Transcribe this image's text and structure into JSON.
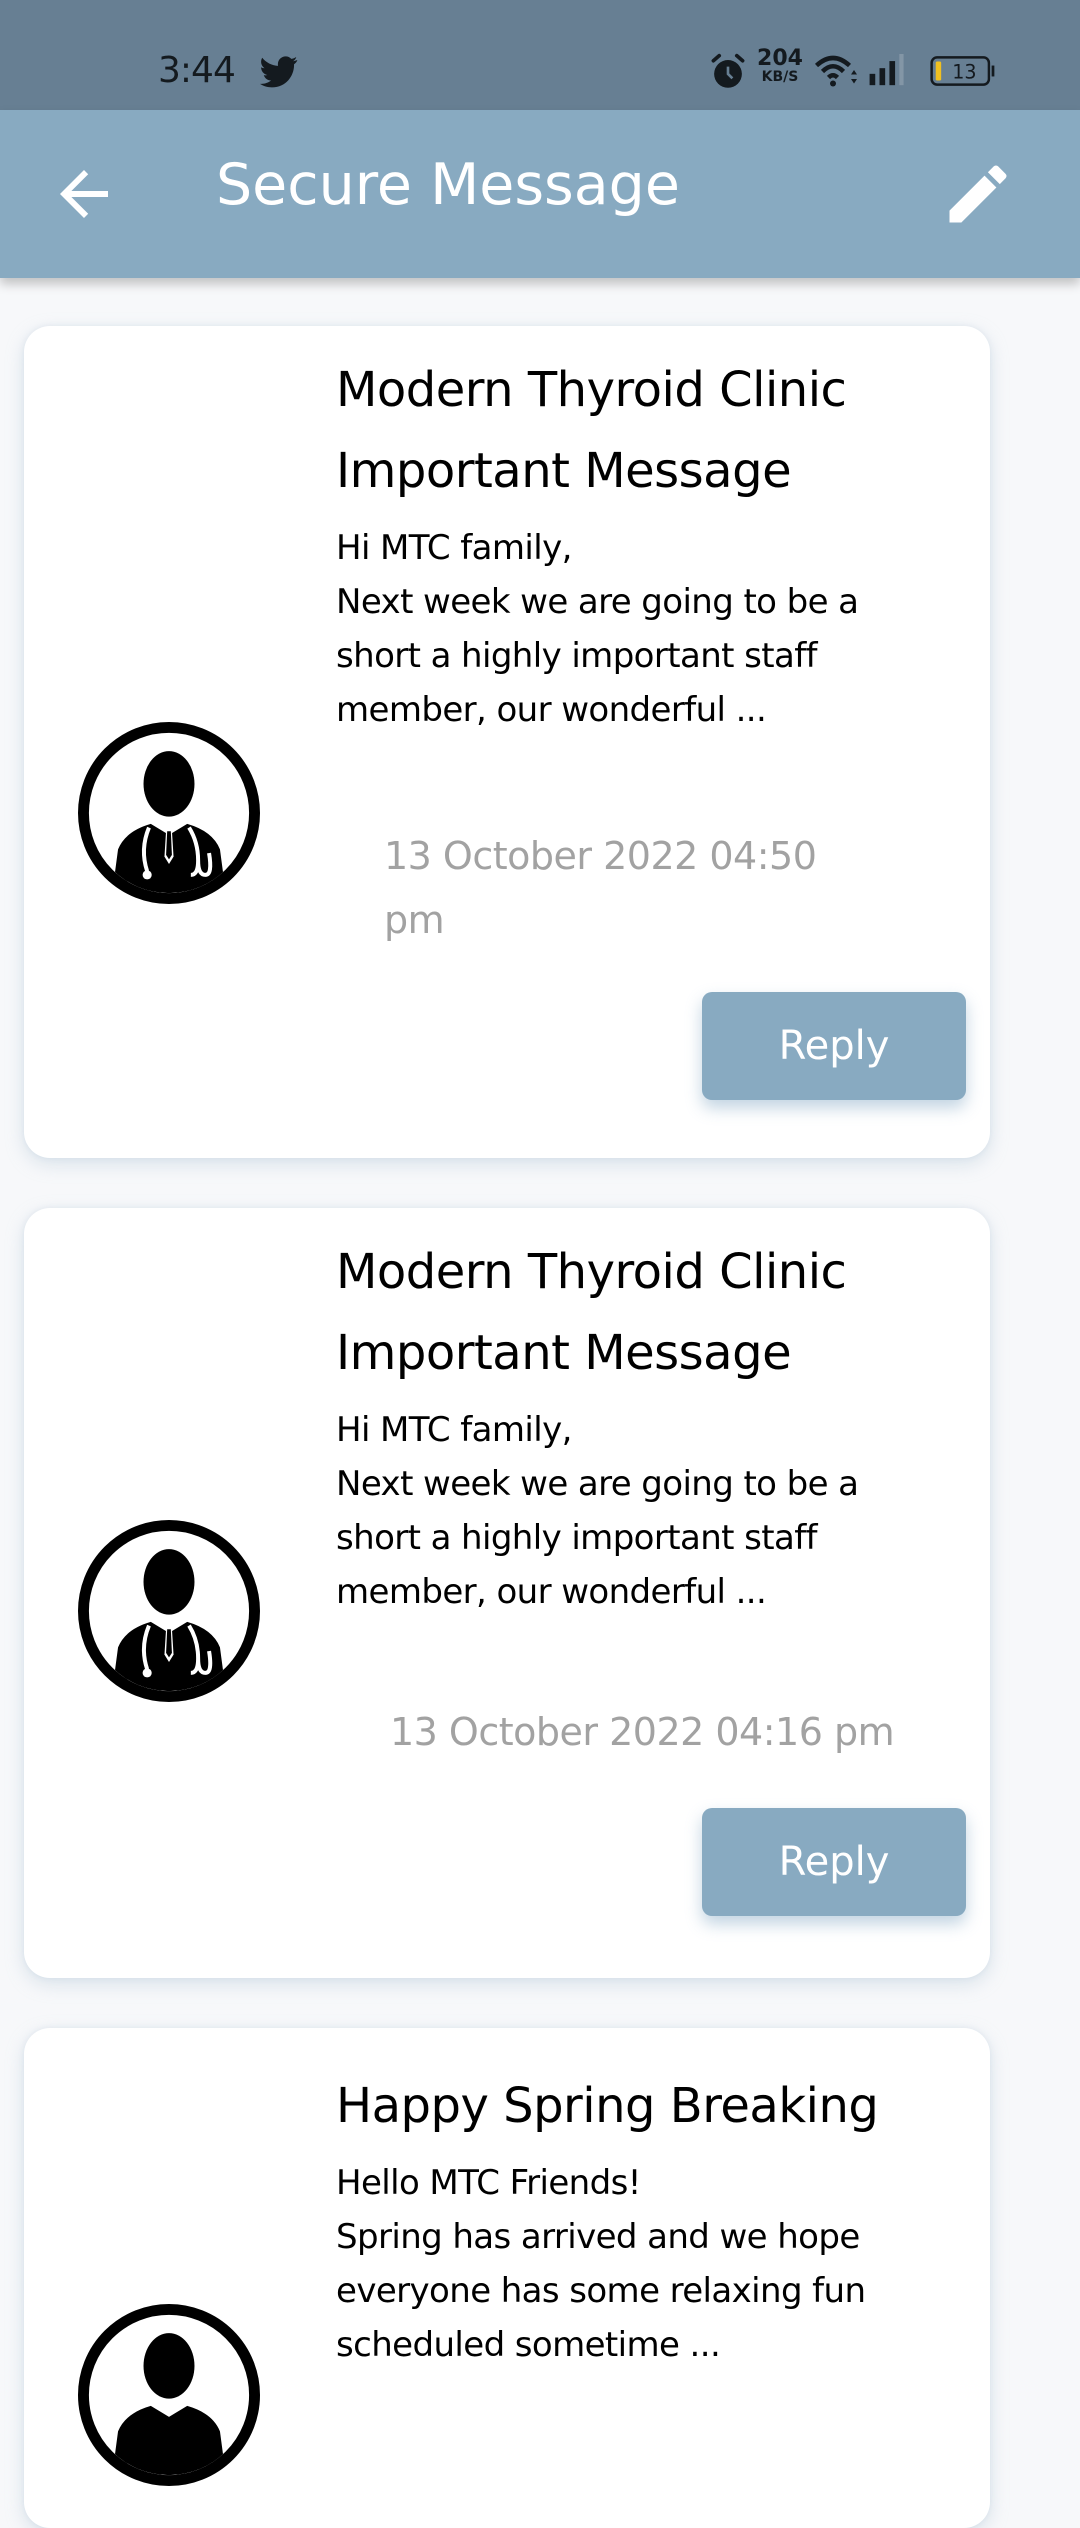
{
  "status_bar": {
    "time": "3:44",
    "notification_icons": [
      "twitter-icon"
    ],
    "alarm_icon": "alarm-icon",
    "net_speed_value": "204",
    "net_speed_unit": "KB/S",
    "wifi_icon": "wifi-icon",
    "signal_icon": "cell-signal-icon",
    "battery_level": "13"
  },
  "app_bar": {
    "title": "Secure Message",
    "back_icon": "arrow-left-icon",
    "edit_icon": "pencil-icon",
    "background_color": "#88aac1"
  },
  "messages": [
    {
      "avatar_icon": "doctor-avatar-icon",
      "title": "Modern Thyroid Clinic Important Message",
      "body": "Hi MTC family,\nNext week we are going to be a short a highly important staff member, our wonderful ...",
      "date": "13 October 2022 04:50 pm",
      "reply_label": "Reply"
    },
    {
      "avatar_icon": "doctor-avatar-icon",
      "title": "Modern Thyroid Clinic Important Message",
      "body": "Hi MTC family,\nNext week we are going to be a short a highly important staff member, our wonderful ...",
      "date": "13 October 2022 04:16 pm",
      "reply_label": "Reply"
    },
    {
      "avatar_icon": "doctor-avatar-icon",
      "title": "Happy Spring Breaking",
      "body": "Hello MTC Friends!\nSpring has arrived and we hope everyone has some relaxing fun scheduled sometime ...",
      "date": "",
      "reply_label": ""
    }
  ],
  "colors": {
    "accent": "#88aac1",
    "status_bar": "#677f93",
    "date_text": "#a2a2a2"
  }
}
